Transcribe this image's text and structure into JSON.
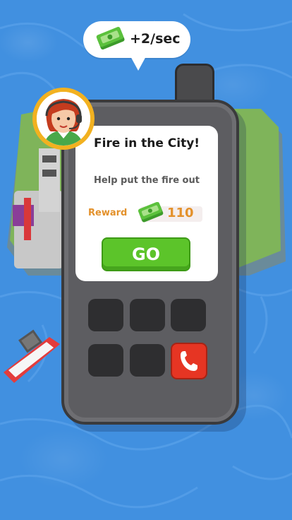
{
  "income": {
    "rate_text": "+2/sec",
    "icon": "cash-stack-icon"
  },
  "mission": {
    "title": "Fire in the City!",
    "description": "Help put the fire out",
    "reward_label": "Reward",
    "reward_value": "110",
    "go_label": "GO"
  },
  "phone": {
    "keys_count": 5,
    "call_icon": "phone-call-icon"
  },
  "avatar": {
    "icon": "operator-avatar-icon"
  },
  "colors": {
    "water": "#4190e0",
    "go_button": "#5cc42a",
    "reward": "#e3912b",
    "call_key": "#e63523",
    "avatar_ring": "#f2b120"
  }
}
